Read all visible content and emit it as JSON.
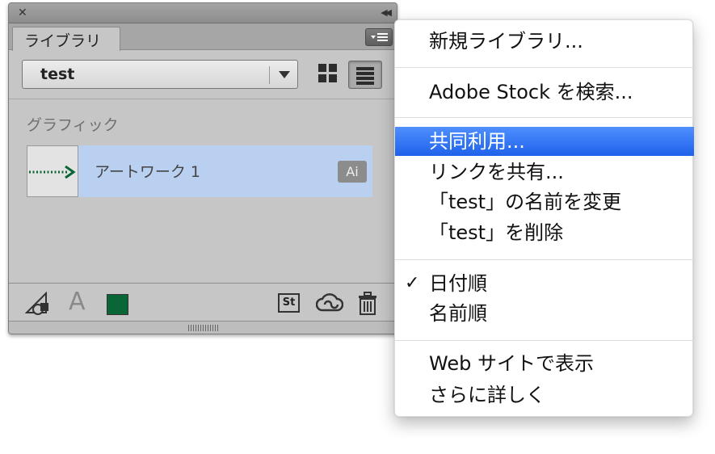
{
  "panel": {
    "tab_label": "ライブラリ",
    "library_select": "test",
    "section_label": "グラフィック",
    "asset": {
      "name": "アートワーク 1",
      "badge": "Ai"
    },
    "footer": {
      "char_style_glyph": "A",
      "stock_label": "St",
      "color_swatch": "#0a6636"
    }
  },
  "menu": {
    "items": [
      {
        "label": "新規ライブラリ..."
      },
      {
        "label": "Adobe Stock を検索..."
      },
      {
        "label": "共同利用..."
      },
      {
        "label": "リンクを共有..."
      },
      {
        "label": "「test」の名前を変更"
      },
      {
        "label": "「test」を削除"
      },
      {
        "label": "日付順",
        "checked": true
      },
      {
        "label": "名前順"
      },
      {
        "label": "Web サイトで表示"
      },
      {
        "label": "さらに詳しく"
      }
    ],
    "check_glyph": "✓",
    "highlight_color": "#2f6ff4"
  }
}
